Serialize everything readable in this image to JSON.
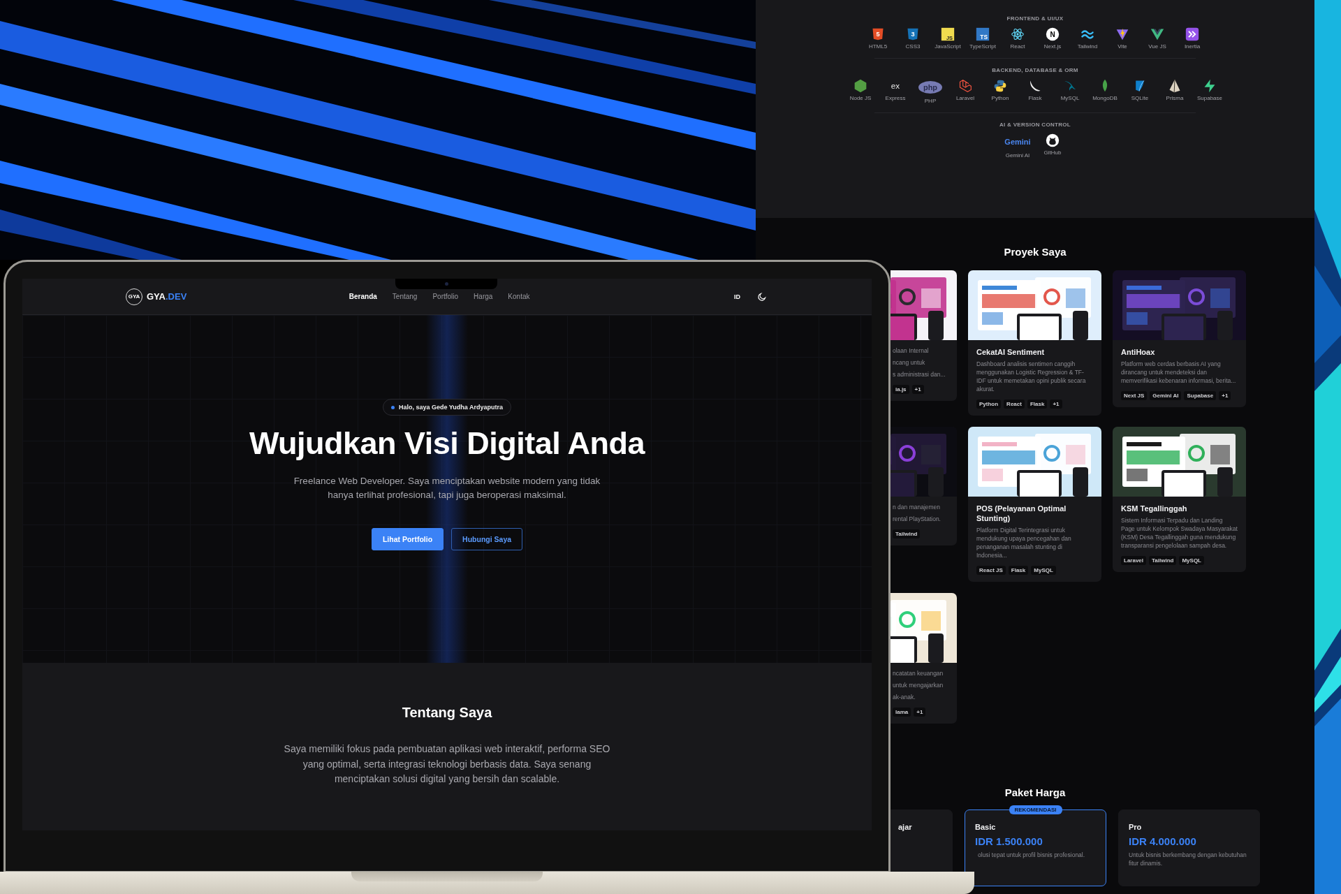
{
  "tech_stack": {
    "groups": [
      {
        "title": "FRONTEND & UI/UX",
        "items": [
          {
            "label": "HTML5",
            "mark": "5"
          },
          {
            "label": "CSS3",
            "mark": "3"
          },
          {
            "label": "JavaScript",
            "mark": "JS"
          },
          {
            "label": "TypeScript",
            "mark": "TS"
          },
          {
            "label": "React"
          },
          {
            "label": "Next.js",
            "mark": "N"
          },
          {
            "label": "Tailwind"
          },
          {
            "label": "Vite"
          },
          {
            "label": "Vue JS"
          },
          {
            "label": "Inertia"
          }
        ]
      },
      {
        "title": "BACKEND, DATABASE & ORM",
        "items": [
          {
            "label": "Node JS"
          },
          {
            "label": "Express",
            "mark": "ex"
          },
          {
            "label": "PHP",
            "mark": "php"
          },
          {
            "label": "Laravel"
          },
          {
            "label": "Python"
          },
          {
            "label": "Flask"
          },
          {
            "label": "MySQL"
          },
          {
            "label": "MongoDB"
          },
          {
            "label": "SQLite"
          },
          {
            "label": "Prisma"
          },
          {
            "label": "Supabase"
          }
        ]
      },
      {
        "title": "AI & VERSION CONTROL",
        "items": [
          {
            "label": "Gemini AI",
            "mark": "Gemini"
          },
          {
            "label": "GitHub"
          }
        ]
      }
    ]
  },
  "projects": {
    "title": "Proyek Saya",
    "cards": [
      {
        "kind": "partial",
        "lines": [
          "olaan Internal",
          "ncang untuk",
          "s administrasi dan..."
        ],
        "tags": [
          "ia.js",
          "+1"
        ]
      },
      {
        "kind": "full",
        "title": "CekatAI Sentiment",
        "description": "Dashboard analisis sentimen canggih menggunakan Logistic Regression & TF-IDF untuk memetakan opini publik secara akurat.",
        "tags": [
          "Python",
          "React",
          "Flask",
          "+1"
        ]
      },
      {
        "kind": "full",
        "title": "AntiHoax",
        "description": "Platform web cerdas berbasis AI yang dirancang untuk mendeteksi dan memverifikasi kebenaran informasi, berita...",
        "tags": [
          "Next JS",
          "Gemini AI",
          "Supabase",
          "+1"
        ]
      },
      {
        "kind": "partial",
        "lines": [
          "n dan manajemen",
          "rental PlayStation."
        ],
        "tags": [
          "Tailwind"
        ]
      },
      {
        "kind": "full",
        "title": "POS (Pelayanan Optimal Stunting)",
        "description": "Platform Digital Terintegrasi untuk mendukung upaya pencegahan dan penanganan masalah stunting di Indonesia...",
        "tags": [
          "React JS",
          "Flask",
          "MySQL"
        ]
      },
      {
        "kind": "full",
        "title": "KSM Tegallinggah",
        "description": "Sistem Informasi Terpadu dan Landing Page untuk Kelompok Swadaya Masyarakat (KSM) Desa Tegallinggah guna mendukung transparansi pengelolaan sampah desa.",
        "tags": [
          "Laravel",
          "Tailwind",
          "MySQL"
        ]
      },
      {
        "kind": "partial",
        "lines": [
          "ncatatan keuangan",
          "untuk mengajarkan",
          "ak-anak."
        ],
        "tags": [
          "lama",
          "+1"
        ]
      }
    ]
  },
  "pricing": {
    "title": "Paket Harga",
    "plans": [
      {
        "kind": "partial",
        "name": "ajar",
        "recommended": false
      },
      {
        "kind": "full",
        "name": "Basic",
        "recommended": true,
        "badge": "REKOMENDASI",
        "price": "IDR 1.500.000",
        "description": "olusi tepat untuk profil bisnis profesional."
      },
      {
        "kind": "full",
        "name": "Pro",
        "recommended": false,
        "price": "IDR 4.000.000",
        "description": "Untuk bisnis berkembang dengan kebutuhan fitur dinamis."
      }
    ]
  },
  "laptop_site": {
    "logo": {
      "mark": "GYA",
      "name": "GYA",
      "suffix": ".DEV"
    },
    "nav": [
      {
        "label": "Beranda",
        "selected": true
      },
      {
        "label": "Tentang",
        "selected": false
      },
      {
        "label": "Portfolio",
        "selected": false
      },
      {
        "label": "Harga",
        "selected": false
      },
      {
        "label": "Kontak",
        "selected": false
      }
    ],
    "language": "ID",
    "hero": {
      "greeting": "Halo, saya Gede Yudha Ardyaputra",
      "headline": "Wujudkan Visi Digital Anda",
      "subtitle": "Freelance Web Developer. Saya menciptakan website modern yang tidak hanya terlihat profesional, tapi juga beroperasi maksimal.",
      "buttons": [
        {
          "label": "Lihat Portfolio",
          "kind": "primary"
        },
        {
          "label": "Hubungi Saya",
          "kind": "outline"
        }
      ]
    },
    "about": {
      "title": "Tentang Saya",
      "text": "Saya memiliki fokus pada pembuatan aplikasi web interaktif, performa SEO yang optimal, serta integrasi teknologi berbasis data. Saya senang menciptakan solusi digital yang bersih dan scalable."
    }
  }
}
